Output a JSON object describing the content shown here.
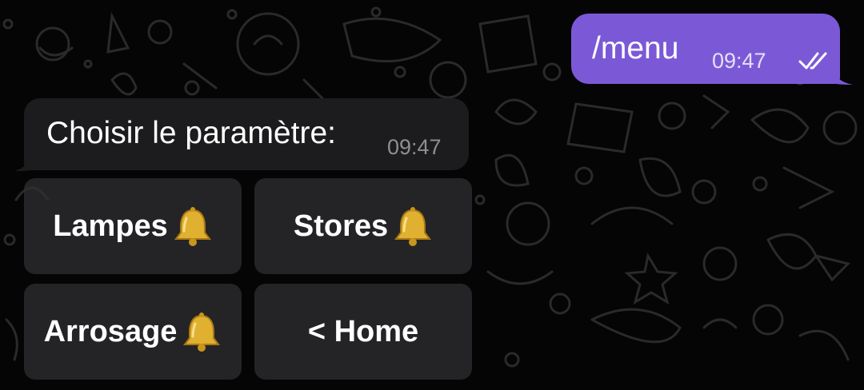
{
  "chat": {
    "outgoing_message": {
      "text": "/menu",
      "time": "09:47",
      "status_icon": "double-check-icon"
    },
    "incoming_message": {
      "text": "Choisir le paramètre:",
      "time": "09:47"
    },
    "keyboard": {
      "buttons": [
        {
          "label": "Lampes",
          "icon": "bell-icon"
        },
        {
          "label": "Stores",
          "icon": "bell-icon"
        },
        {
          "label": "Arrosage",
          "icon": "bell-icon"
        },
        {
          "label": "< Home",
          "icon": ""
        }
      ]
    }
  },
  "colors": {
    "background": "#050505",
    "outgoing_bubble": "#7b59d6",
    "incoming_bubble": "#1c1c1e",
    "button": "#303034"
  }
}
